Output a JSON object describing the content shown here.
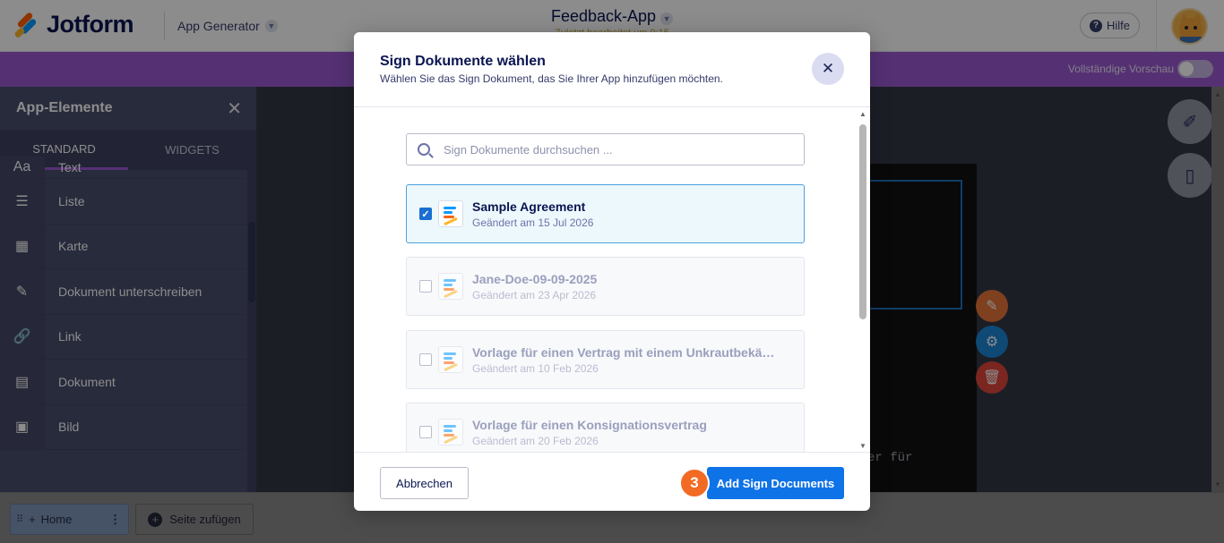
{
  "header": {
    "brand": "Jotform",
    "app_generator_label": "App Generator",
    "app_title": "Feedback-App",
    "app_subtitle": "Zuletzt bearbeitet um 9:15",
    "help_label": "Hilfe"
  },
  "preview": {
    "label": "Vollständige Vorschau"
  },
  "sidebar": {
    "title": "App-Elemente",
    "tabs": [
      {
        "label": "STANDARD"
      },
      {
        "label": "WIDGETS"
      }
    ],
    "items": [
      {
        "label": "Text",
        "icon": "Aa"
      },
      {
        "label": "Liste",
        "icon": "☰"
      },
      {
        "label": "Karte",
        "icon": "▦"
      },
      {
        "label": "Dokument unterschreiben",
        "icon": "✎"
      },
      {
        "label": "Link",
        "icon": "🔗"
      },
      {
        "label": "Dokument",
        "icon": "▤"
      },
      {
        "label": "Bild",
        "icon": "▣"
      }
    ]
  },
  "canvas": {
    "text_fragment": "er für"
  },
  "bottom": {
    "home_tab": "Home",
    "add_page": "Seite zufügen"
  },
  "modal": {
    "title": "Sign Dokumente wählen",
    "subtitle": "Wählen Sie das Sign Dokument, das Sie Ihrer App hinzufügen möchten.",
    "search_placeholder": "Sign Dokumente durchsuchen ...",
    "documents": [
      {
        "name": "Sample Agreement",
        "modified": "Geändert am 15 Jul 2026",
        "selected": true
      },
      {
        "name": "Jane-Doe-09-09-2025",
        "modified": "Geändert am 23 Apr 2026",
        "selected": false
      },
      {
        "name": "Vorlage für einen Vertrag mit einem Unkrautbekä…",
        "modified": "Geändert am 10 Feb 2026",
        "selected": false
      },
      {
        "name": "Vorlage für einen Konsignationsvertrag",
        "modified": "Geändert am 20 Feb 2026",
        "selected": false
      }
    ],
    "cancel_label": "Abbrechen",
    "add_label": "Add Sign Documents",
    "step_number": "3"
  },
  "colors": {
    "brand_navy": "#0a1551",
    "purple": "#9b59d3",
    "primary_blue": "#0f73e8",
    "step_orange": "#f26a24"
  }
}
